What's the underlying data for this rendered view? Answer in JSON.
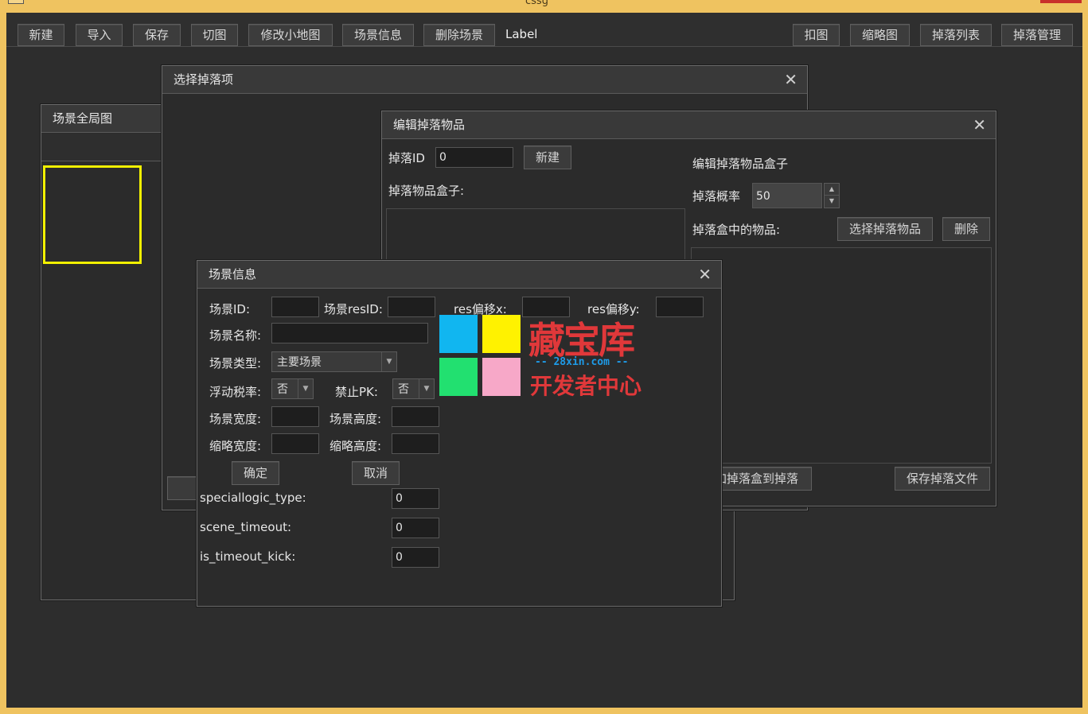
{
  "window": {
    "title": "cssg"
  },
  "toolbar": {
    "buttons": [
      "新建",
      "导入",
      "保存",
      "切图",
      "修改小地图",
      "场景信息",
      "删除场景"
    ],
    "label": "Label",
    "right_buttons": [
      "扣图",
      "缩略图",
      "掉落列表",
      "掉落管理"
    ]
  },
  "overview": {
    "title": "场景全局图"
  },
  "select_drop": {
    "title": "选择掉落项"
  },
  "edit_drop": {
    "title": "编辑掉落物品",
    "drop_id_label": "掉落ID",
    "drop_id_value": "0",
    "new_button": "新建",
    "box_label": "掉落物品盒子:",
    "edit_box_label": "编辑掉落物品盒子",
    "prob_label": "掉落概率",
    "prob_value": "50",
    "items_label": "掉落盒中的物品:",
    "select_items_button": "选择掉落物品",
    "delete_button": "删除",
    "add_box_button": "添加掉落盒到掉落",
    "save_button": "保存掉落文件"
  },
  "scene_info": {
    "title": "场景信息",
    "scene_id_label": "场景ID:",
    "scene_resid_label": "场景resID:",
    "resx_label": "res偏移x:",
    "resy_label": "res偏移y:",
    "name_label": "场景名称:",
    "type_label": "场景类型:",
    "type_value": "主要场景",
    "tax_label": "浮动税率:",
    "tax_value": "否",
    "pk_label": "禁止PK:",
    "pk_value": "否",
    "width_label": "场景宽度:",
    "height_label": "场景高度:",
    "thumb_width_label": "缩略宽度:",
    "thumb_height_label": "缩略高度:",
    "ok_button": "确定",
    "cancel_button": "取消",
    "special_label": "speciallogic_type:",
    "special_value": "0",
    "timeout_label": "scene_timeout:",
    "timeout_value": "0",
    "kick_label": "is_timeout_kick:",
    "kick_value": "0"
  },
  "watermark": {
    "brand": "藏宝库",
    "domain": "-- 28xin.com --",
    "slogan": "开发者中心",
    "colors": [
      "#11b6f0",
      "#fff200",
      "#22e070",
      "#f7a8c8"
    ]
  }
}
